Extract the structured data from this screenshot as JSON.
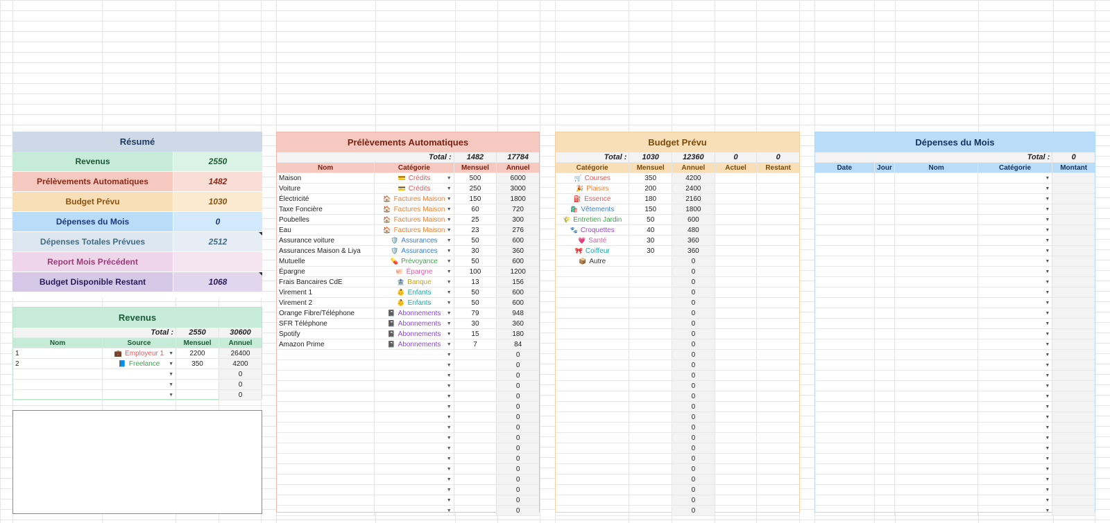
{
  "resume": {
    "title": "Résumé",
    "rows": [
      {
        "label": "Revenus",
        "value": "2550"
      },
      {
        "label": "Prélèvements Automatiques",
        "value": "1482"
      },
      {
        "label": "Budget Prévu",
        "value": "1030"
      },
      {
        "label": "Dépenses du Mois",
        "value": "0"
      },
      {
        "label": "Dépenses Totales Prévues",
        "value": "2512"
      },
      {
        "label": "Report Mois Précédent",
        "value": ""
      },
      {
        "label": "Budget Disponible Restant",
        "value": "1068"
      }
    ],
    "colors": [
      "#c6ebd9",
      "#f5c9bf",
      "#f8dfb8",
      "#b9dcf9",
      "#dce6f0",
      "#eed5e9",
      "#d6c7e6"
    ],
    "value_colors": [
      "#dbf3e6",
      "#f9ded7",
      "#fbeacf",
      "#d2e8fb",
      "#e6edf5",
      "#f4e4f0",
      "#e1d6ee"
    ],
    "text_colors": [
      "#1c5a36",
      "#8a2a1a",
      "#8a5210",
      "#1a3b78",
      "#3e6e86",
      "#9a3c78",
      "#2a1a5c"
    ]
  },
  "revenus": {
    "title": "Revenus",
    "total_label": "Total :",
    "total_mensuel": "2550",
    "total_annuel": "30600",
    "headers": [
      "Nom",
      "Source",
      "Mensuel",
      "Annuel"
    ],
    "rows": [
      {
        "nom": "1",
        "source": "Employeur 1",
        "icon": "💼",
        "color": "#e05a5a",
        "mensuel": "2200",
        "annuel": "26400"
      },
      {
        "nom": "2",
        "source": "Freelance",
        "icon": "📘",
        "color": "#3aa84a",
        "mensuel": "350",
        "annuel": "4200"
      },
      {
        "nom": "",
        "source": "",
        "icon": "",
        "color": "#333",
        "mensuel": "",
        "annuel": "0"
      },
      {
        "nom": "",
        "source": "",
        "icon": "",
        "color": "#333",
        "mensuel": "",
        "annuel": "0"
      },
      {
        "nom": "",
        "source": "",
        "icon": "",
        "color": "#333",
        "mensuel": "",
        "annuel": "0"
      }
    ]
  },
  "prelevements": {
    "title": "Prélèvements Automatiques",
    "total_label": "Total :",
    "total_mensuel": "1482",
    "total_annuel": "17784",
    "headers": [
      "Nom",
      "Catégorie",
      "Mensuel",
      "Annuel"
    ],
    "rows": [
      {
        "nom": "Maison",
        "cat": "Crédits",
        "icon": "💳",
        "color": "#e05a5a",
        "mensuel": "500",
        "annuel": "6000"
      },
      {
        "nom": "Voiture",
        "cat": "Crédits",
        "icon": "💳",
        "color": "#e05a5a",
        "mensuel": "250",
        "annuel": "3000"
      },
      {
        "nom": "Électricité",
        "cat": "Factures Maison",
        "icon": "🏠",
        "color": "#e8843a",
        "mensuel": "150",
        "annuel": "1800"
      },
      {
        "nom": "Taxe Foncière",
        "cat": "Factures Maison",
        "icon": "🏠",
        "color": "#e8843a",
        "mensuel": "60",
        "annuel": "720"
      },
      {
        "nom": "Poubelles",
        "cat": "Factures Maison",
        "icon": "🏠",
        "color": "#e8843a",
        "mensuel": "25",
        "annuel": "300"
      },
      {
        "nom": "Eau",
        "cat": "Factures Maison",
        "icon": "🏠",
        "color": "#e8843a",
        "mensuel": "23",
        "annuel": "276"
      },
      {
        "nom": "Assurance voiture",
        "cat": "Assurances",
        "icon": "🛡️",
        "color": "#3a7fd6",
        "mensuel": "50",
        "annuel": "600"
      },
      {
        "nom": "Assurances Maison & Liya",
        "cat": "Assurances",
        "icon": "🛡️",
        "color": "#3a7fd6",
        "mensuel": "30",
        "annuel": "360"
      },
      {
        "nom": "Mutuelle",
        "cat": "Prévoyance",
        "icon": "💊",
        "color": "#3aa84a",
        "mensuel": "50",
        "annuel": "600"
      },
      {
        "nom": "Épargne",
        "cat": "Épargne",
        "icon": "🐖",
        "color": "#e05aa8",
        "mensuel": "100",
        "annuel": "1200"
      },
      {
        "nom": "Frais Bancaires CdE",
        "cat": "Banque",
        "icon": "🏦",
        "color": "#c9a31a",
        "mensuel": "13",
        "annuel": "156"
      },
      {
        "nom": "Virement 1",
        "cat": "Enfants",
        "icon": "👶",
        "color": "#1aa8a8",
        "mensuel": "50",
        "annuel": "600"
      },
      {
        "nom": "Virement 2",
        "cat": "Enfants",
        "icon": "👶",
        "color": "#1aa8a8",
        "mensuel": "50",
        "annuel": "600"
      },
      {
        "nom": "Orange Fibre/Téléphone",
        "cat": "Abonnements",
        "icon": "📓",
        "color": "#8a4ad6",
        "mensuel": "79",
        "annuel": "948"
      },
      {
        "nom": "SFR Téléphone",
        "cat": "Abonnements",
        "icon": "📓",
        "color": "#8a4ad6",
        "mensuel": "30",
        "annuel": "360"
      },
      {
        "nom": "Spotify",
        "cat": "Abonnements",
        "icon": "📓",
        "color": "#8a4ad6",
        "mensuel": "15",
        "annuel": "180"
      },
      {
        "nom": "Amazon Prime",
        "cat": "Abonnements",
        "icon": "📓",
        "color": "#8a4ad6",
        "mensuel": "7",
        "annuel": "84"
      }
    ],
    "empty_rows": 16,
    "empty_annuel": "0"
  },
  "budget": {
    "title": "Budget Prévu",
    "total_label": "Total :",
    "total_mensuel": "1030",
    "total_annuel": "12360",
    "total_actuel": "0",
    "total_restant": "0",
    "headers": [
      "Catégorie",
      "Mensuel",
      "Annuel",
      "Actuel",
      "Restant"
    ],
    "rows": [
      {
        "cat": "Courses",
        "icon": "🛒",
        "color": "#e05a5a",
        "mensuel": "350",
        "annuel": "4200"
      },
      {
        "cat": "Plaisirs",
        "icon": "🎉",
        "color": "#e8843a",
        "mensuel": "200",
        "annuel": "2400"
      },
      {
        "cat": "Essence",
        "icon": "⛽",
        "color": "#e05a5a",
        "mensuel": "180",
        "annuel": "2160"
      },
      {
        "cat": "Vêtements",
        "icon": "🛍️",
        "color": "#3a7fd6",
        "mensuel": "150",
        "annuel": "1800"
      },
      {
        "cat": "Entretien Jardin",
        "icon": "🌾",
        "color": "#3aa84a",
        "mensuel": "50",
        "annuel": "600"
      },
      {
        "cat": "Croquettes",
        "icon": "🐾",
        "color": "#a04ad6",
        "mensuel": "40",
        "annuel": "480"
      },
      {
        "cat": "Santé",
        "icon": "💗",
        "color": "#e05aa8",
        "mensuel": "30",
        "annuel": "360"
      },
      {
        "cat": "Coiffeur",
        "icon": "🎀",
        "color": "#1aa8a8",
        "mensuel": "30",
        "annuel": "360"
      },
      {
        "cat": "Autre",
        "icon": "📦",
        "color": "#333333",
        "mensuel": "",
        "annuel": "0"
      }
    ],
    "empty_rows": 24,
    "empty_annuel": "0"
  },
  "depenses": {
    "title": "Dépenses du Mois",
    "total_label": "Total :",
    "total_montant": "0",
    "headers": [
      "Date",
      "Jour",
      "Nom",
      "Catégorie",
      "Montant"
    ],
    "rows_count": 33
  }
}
